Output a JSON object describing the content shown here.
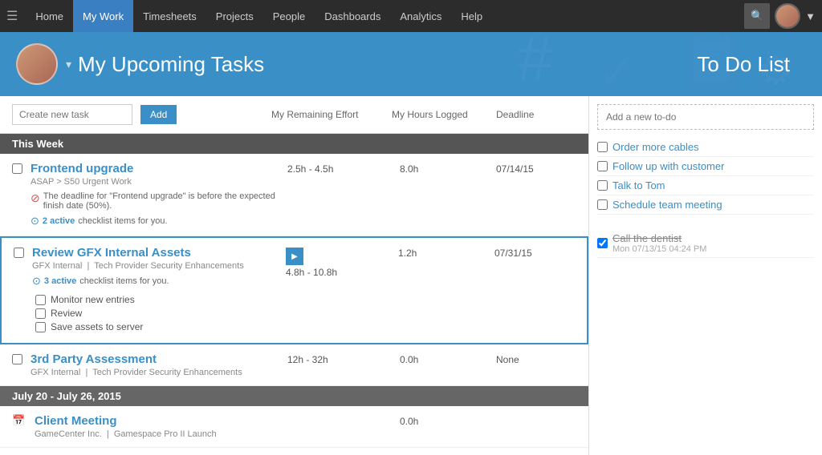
{
  "nav": {
    "menu_icon": "☰",
    "items": [
      {
        "label": "Home",
        "active": false
      },
      {
        "label": "My Work",
        "active": true
      },
      {
        "label": "Timesheets",
        "active": false
      },
      {
        "label": "Projects",
        "active": false
      },
      {
        "label": "People",
        "active": false
      },
      {
        "label": "Dashboards",
        "active": false
      },
      {
        "label": "Analytics",
        "active": false
      },
      {
        "label": "Help",
        "active": false
      }
    ]
  },
  "header": {
    "title": "My Upcoming Tasks",
    "todo_title": "To Do List"
  },
  "task_toolbar": {
    "input_placeholder": "Create new task",
    "add_button": "Add"
  },
  "col_headers": {
    "effort": "My Remaining Effort",
    "hours": "My Hours Logged",
    "deadline": "Deadline"
  },
  "week_sections": [
    {
      "label": "This Week",
      "tasks": [
        {
          "id": "frontend-upgrade",
          "title": "Frontend upgrade",
          "subtitle": "ASAP > S50 Urgent Work",
          "effort": "2.5h - 4.5h",
          "hours": "8.0h",
          "deadline": "07/14/15",
          "has_warning": true,
          "warning_text": "The deadline for \"Frontend upgrade\" is before the expected finish date (50%).",
          "checklist_count": 2,
          "checklist_label": "active checklist items for you.",
          "selected": false
        },
        {
          "id": "review-gfx",
          "title": "Review GFX Internal Assets",
          "subtitle": "GFX Internal  |  Tech Provider Security Enhancements",
          "effort": "4.8h - 10.8h",
          "hours": "1.2h",
          "deadline": "07/31/15",
          "has_warning": false,
          "warning_text": "",
          "checklist_count": 3,
          "checklist_label": "active checklist items for you.",
          "selected": true,
          "checklist_items": [
            {
              "label": "Monitor new entries",
              "checked": false
            },
            {
              "label": "Review",
              "checked": false
            },
            {
              "label": "Save assets to server",
              "checked": false
            }
          ]
        },
        {
          "id": "3rd-party",
          "title": "3rd Party Assessment",
          "subtitle": "GFX Internal  |  Tech Provider Security Enhancements",
          "effort": "12h - 32h",
          "hours": "0.0h",
          "deadline": "None",
          "has_warning": false,
          "warning_text": "",
          "checklist_count": 0,
          "checklist_label": "",
          "selected": false
        }
      ]
    }
  ],
  "date_sections": [
    {
      "label": "July 20 - July 26, 2015",
      "tasks": [
        {
          "id": "client-meeting",
          "title": "Client Meeting",
          "subtitle": "GameCenter Inc.  |  Gamespace Pro II Launch",
          "effort": "",
          "hours": "0.0h",
          "deadline": "",
          "has_warning": false,
          "warning_text": "",
          "checklist_count": 0,
          "checklist_label": "",
          "selected": false
        }
      ]
    }
  ],
  "todo": {
    "add_placeholder": "Add a new to-do",
    "items": [
      {
        "label": "Order more cables",
        "completed": false
      },
      {
        "label": "Follow up with customer",
        "completed": false
      },
      {
        "label": "Talk to Tom",
        "completed": false
      },
      {
        "label": "Schedule team meeting",
        "completed": false
      }
    ],
    "completed_items": [
      {
        "label": "Call the dentist",
        "completed": true,
        "time": "Mon 07/13/15 04:24 PM"
      }
    ]
  }
}
